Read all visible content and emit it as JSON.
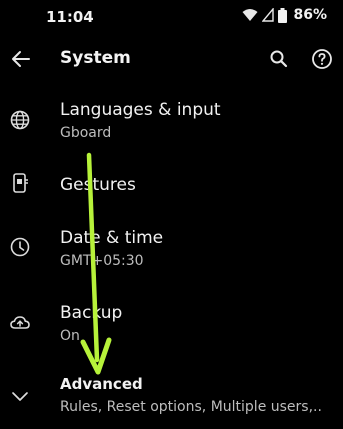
{
  "status_bar": {
    "time": "11:04",
    "battery": "86%"
  },
  "app_bar": {
    "title": "System"
  },
  "items": [
    {
      "label": "Languages & input",
      "sub": "Gboard"
    },
    {
      "label": "Gestures"
    },
    {
      "label": "Date & time",
      "sub": "GMT+05:30"
    },
    {
      "label": "Backup",
      "sub": "On"
    },
    {
      "label": "Advanced",
      "sub": "Rules, Reset options, Multiple users,.."
    }
  ],
  "colors": {
    "background": "#000000",
    "arrow": "#b7f23a",
    "text": "#f2f2f2",
    "subtext": "#bdbdbd"
  }
}
